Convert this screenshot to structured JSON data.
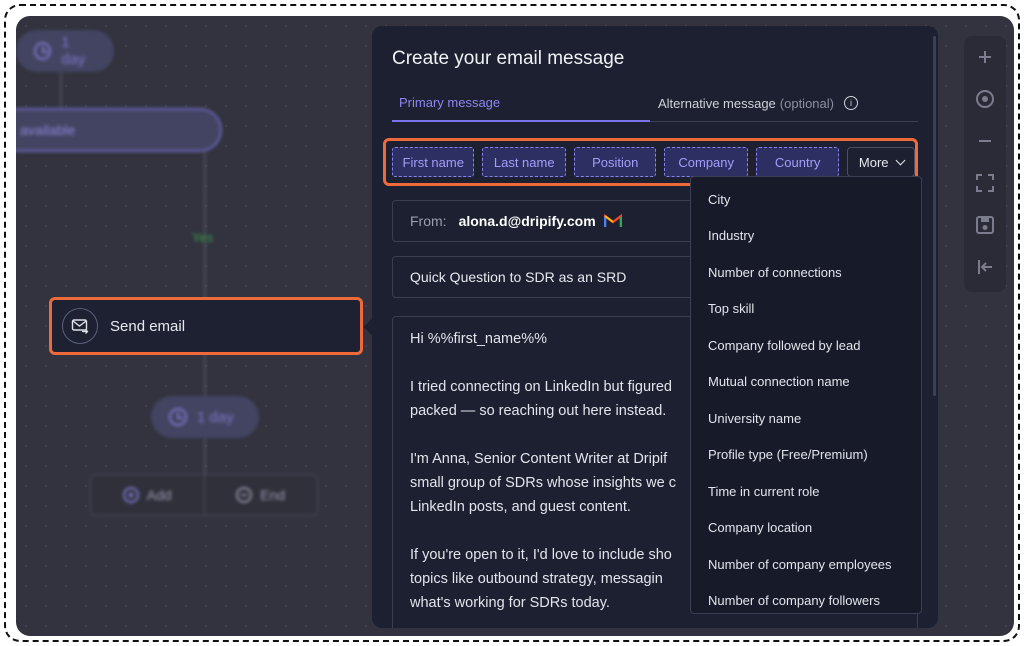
{
  "workflow": {
    "delay_top": "1 day",
    "available_label": "available",
    "yes_label": "Yes",
    "send_email_label": "Send email",
    "delay_bottom": "1 day",
    "add_label": "Add",
    "end_label": "End"
  },
  "toolbar": {
    "icons": [
      "plus-icon",
      "target-icon",
      "minus-icon",
      "fit-screen-icon",
      "save-icon",
      "exit-icon"
    ]
  },
  "panel": {
    "title": "Create your email message",
    "tabs": {
      "primary": "Primary message",
      "alternative": "Alternative message",
      "alternative_suffix": "(optional)"
    },
    "variables": [
      "First name",
      "Last name",
      "Position",
      "Company",
      "Country"
    ],
    "more_label": "More",
    "from_label": "From:",
    "from_value": "alona.d@dripify.com",
    "subject": "Quick Question to SDR as an SRD",
    "body": {
      "greeting": "Hi %%first_name%%",
      "p1_l1": "I tried connecting on LinkedIn but figured",
      "p1_l2": "packed — so reaching out here instead.",
      "p2_l1": "I'm Anna, Senior Content Writer at Dripif",
      "p2_l2": "small group of SDRs whose insights we c",
      "p2_l3": "LinkedIn posts, and guest content.",
      "p3_l1": "If you're open to it, I'd love to include sho",
      "p3_l2": "topics like outbound strategy, messagin",
      "p3_l3": "what's working for SDRs today."
    }
  },
  "dropdown": {
    "items": [
      "City",
      "Industry",
      "Number of connections",
      "Top skill",
      "Company followed by lead",
      "Mutual connection name",
      "University name",
      "Profile type (Free/Premium)",
      "Time in current role",
      "Company location",
      "Number of company employees",
      "Number of company followers"
    ]
  },
  "colors": {
    "highlight": "#ef6a3a",
    "accent": "#7b72ec",
    "panel_bg": "#1c2030",
    "canvas_bg": "#32333e"
  }
}
